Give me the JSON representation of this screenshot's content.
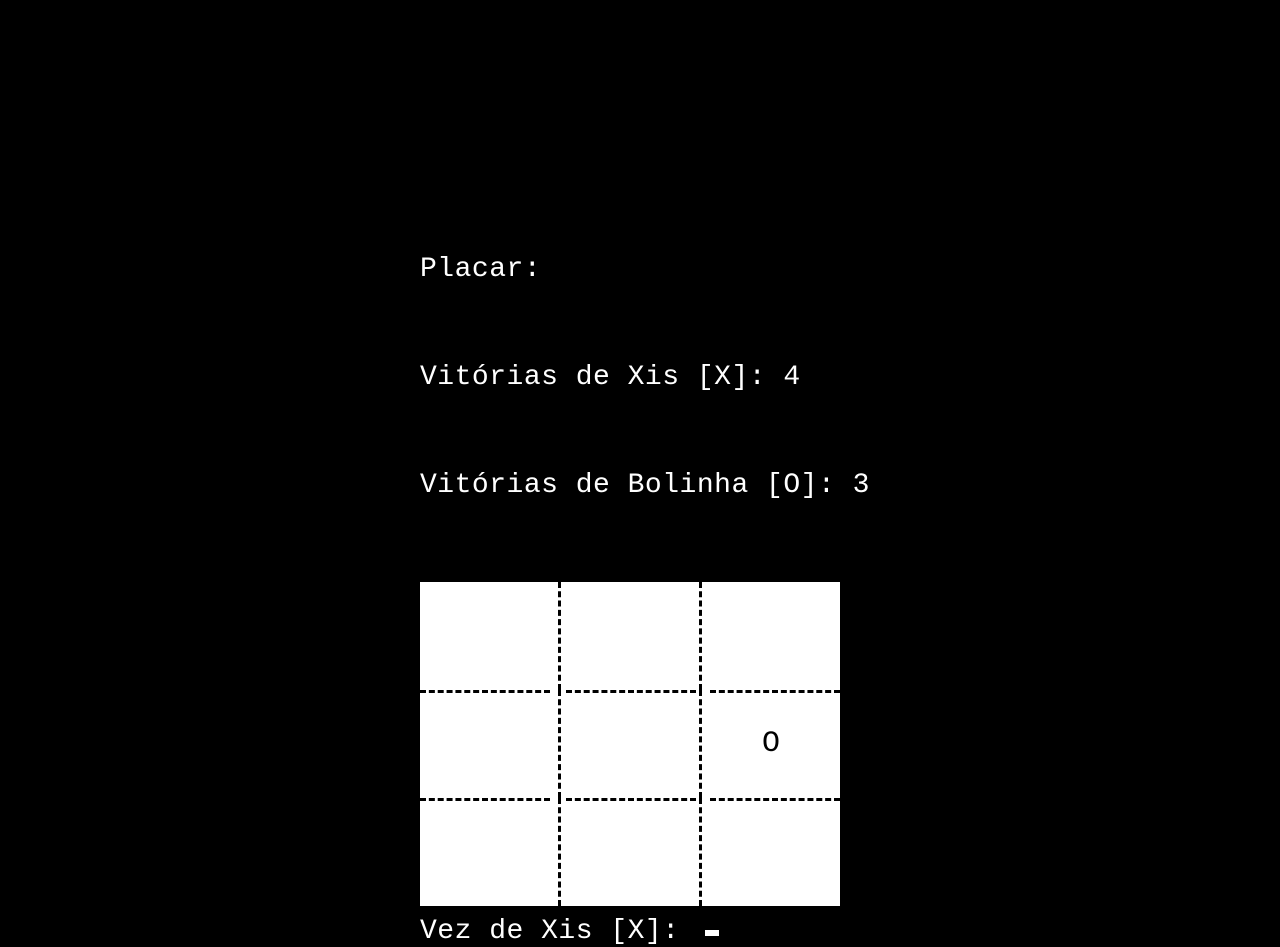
{
  "score": {
    "title": "Placar:",
    "x_label": "Vitórias de Xis [X]: ",
    "x_wins": "4",
    "o_label": "Vitórias de Bolinha [O]: ",
    "o_wins": "3"
  },
  "board": {
    "cells": [
      [
        "",
        "",
        ""
      ],
      [
        "",
        "",
        "O"
      ],
      [
        "",
        "",
        ""
      ]
    ]
  },
  "prompt": {
    "text": "Vez de Xis [X]: "
  }
}
